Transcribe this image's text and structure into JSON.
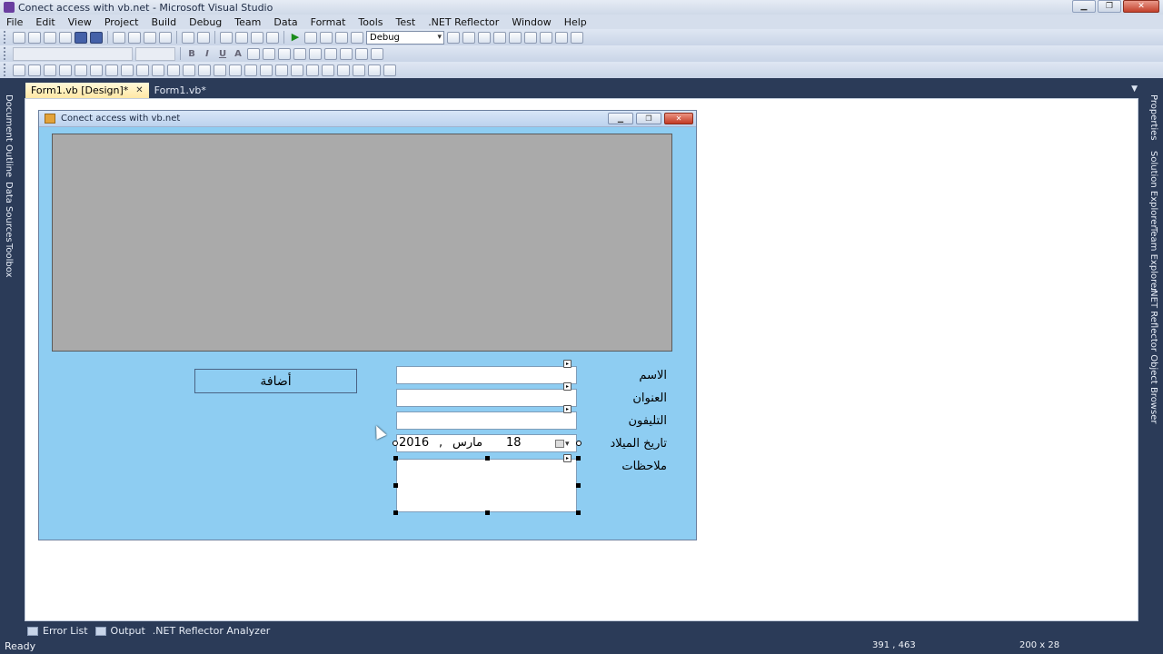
{
  "window": {
    "title": "Conect access with vb.net - Microsoft Visual Studio",
    "minimize": "▁",
    "maximize": "❐",
    "close": "✕"
  },
  "menu": [
    "File",
    "Edit",
    "View",
    "Project",
    "Build",
    "Debug",
    "Team",
    "Data",
    "Format",
    "Tools",
    "Test",
    ".NET Reflector",
    "Window",
    "Help"
  ],
  "toolbar": {
    "configuration": "Debug"
  },
  "left_panes": [
    "Document Outline",
    "Data Sources",
    "Toolbox"
  ],
  "right_panes": [
    "Properties",
    "Solution Explorer",
    "Team Explorer",
    ".NET Reflector Object Browser"
  ],
  "tabs": [
    {
      "label": "Form1.vb [Design]*",
      "close": "✕"
    },
    {
      "label": "Form1.vb*"
    }
  ],
  "form": {
    "title": "Conect access with vb.net",
    "add_button": "أضافة",
    "labels": {
      "name": "الاسم",
      "address": "العنوان",
      "phone": "التليفون",
      "birth_date": "تاريخ الميلاد",
      "notes": "ملاحظات"
    },
    "date_picker": {
      "day": "18",
      "month": "مارس",
      "comma": ",",
      "year": "2016"
    }
  },
  "bottom_tabs": [
    "Error List",
    "Output",
    ".NET Reflector Analyzer"
  ],
  "status": {
    "text": "Ready",
    "position": "391 , 463",
    "size": "200 x 28"
  },
  "colors": {
    "ide_background": "#2b3b58",
    "form_background": "#8ecdf2",
    "grid_background": "#aaaaaa",
    "active_tab": "#ffe8a6"
  }
}
